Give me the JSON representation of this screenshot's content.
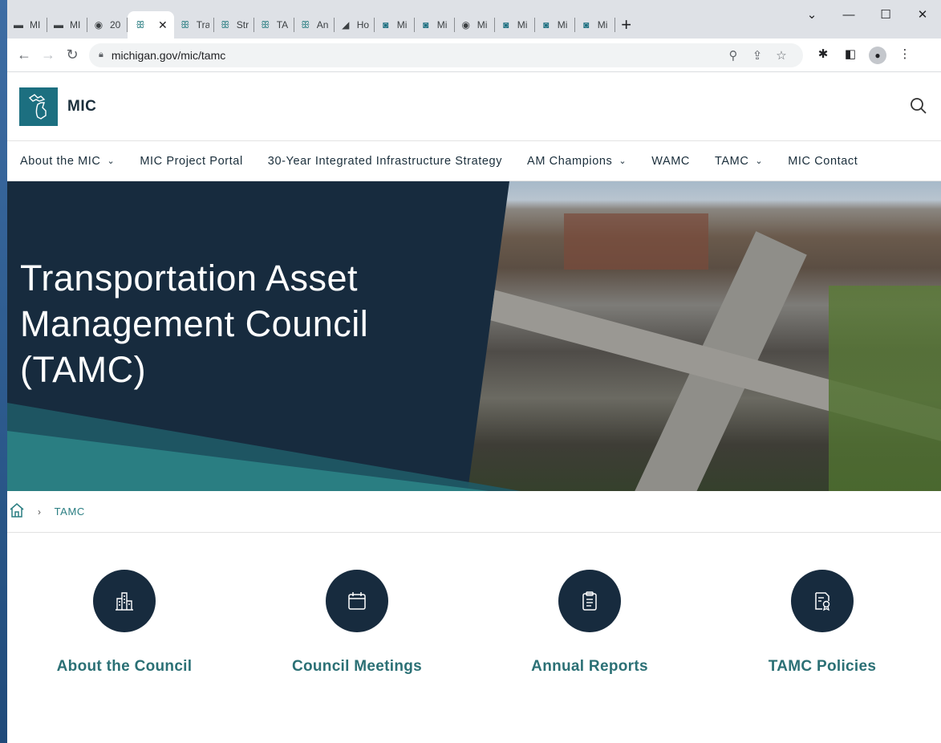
{
  "browser": {
    "tabs": [
      {
        "icon": "mi-flag-icon",
        "title": "MI"
      },
      {
        "icon": "mi-flag-icon",
        "title": "MI"
      },
      {
        "icon": "globe-icon",
        "title": "20"
      },
      {
        "icon": "michigan-icon",
        "title": "",
        "active": true
      },
      {
        "icon": "michigan-icon",
        "title": "Tra"
      },
      {
        "icon": "michigan-icon",
        "title": "Str"
      },
      {
        "icon": "michigan-icon",
        "title": "TA"
      },
      {
        "icon": "michigan-icon",
        "title": "An"
      },
      {
        "icon": "black-square-icon",
        "title": "Ho"
      },
      {
        "icon": "mi-state-icon",
        "title": "Mi"
      },
      {
        "icon": "mi-state-icon",
        "title": "Mi"
      },
      {
        "icon": "globe-icon",
        "title": "Mi"
      },
      {
        "icon": "mi-state-icon",
        "title": "Mi"
      },
      {
        "icon": "mi-state-icon",
        "title": "Mi"
      },
      {
        "icon": "mi-state-icon",
        "title": "Mi"
      }
    ],
    "url": "michigan.gov/mic/tamc"
  },
  "site": {
    "name": "MIC"
  },
  "nav": {
    "items": [
      {
        "label": "About the MIC",
        "dropdown": true
      },
      {
        "label": "MIC Project Portal",
        "dropdown": false
      },
      {
        "label": "30-Year Integrated Infrastructure Strategy",
        "dropdown": false
      },
      {
        "label": "AM Champions",
        "dropdown": true
      },
      {
        "label": "WAMC",
        "dropdown": false
      },
      {
        "label": "TAMC",
        "dropdown": true
      },
      {
        "label": "MIC Contact",
        "dropdown": false
      }
    ]
  },
  "hero": {
    "title_line1": "Transportation Asset",
    "title_line2": "Management Council",
    "title_line3": "(TAMC)"
  },
  "breadcrumb": {
    "current": "TAMC"
  },
  "cards": [
    {
      "icon": "buildings-icon",
      "label": "About the Council"
    },
    {
      "icon": "calendar-icon",
      "label": "Council Meetings"
    },
    {
      "icon": "clipboard-icon",
      "label": "Annual Reports"
    },
    {
      "icon": "policy-document-icon",
      "label": "TAMC Policies"
    }
  ],
  "colors": {
    "navy": "#172b3e",
    "teal": "#2b7075",
    "logo_teal": "#1c6f80"
  }
}
